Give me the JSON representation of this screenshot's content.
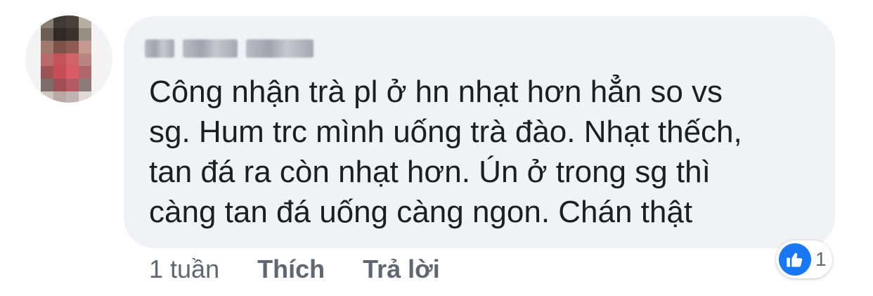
{
  "comment": {
    "author_name": "",
    "text_lines": [
      "Công nhận trà pl ở hn nhạt hơn hẳn so vs",
      "sg. Hum trc mình uống trà đào. Nhạt thếch,",
      "tan đá ra còn nhạt hơn. Ún ở trong sg thì",
      "càng tan đá uống càng ngon. Chán thật"
    ],
    "timestamp": "1 tuần",
    "like_label": "Thích",
    "reply_label": "Trả lời",
    "reaction_count": "1",
    "reaction_icon": "thumbs-up-icon"
  },
  "colors": {
    "bubble_bg": "#f1f2f5",
    "text": "#1c1e21",
    "meta": "#606770",
    "like_blue": "#1877f2"
  }
}
